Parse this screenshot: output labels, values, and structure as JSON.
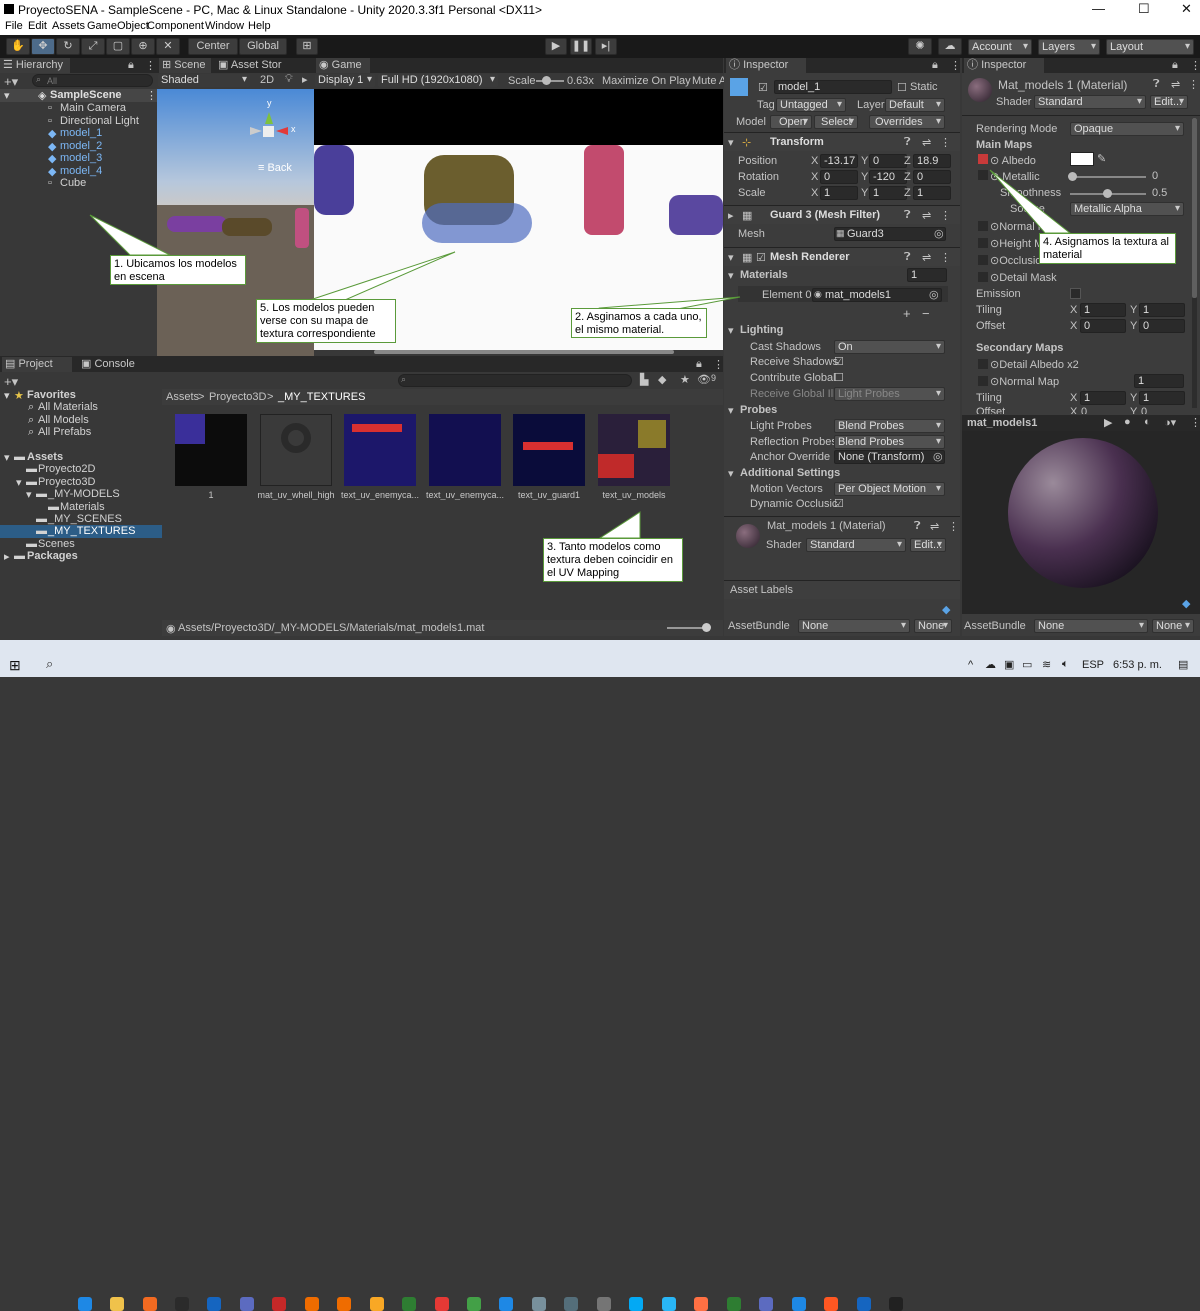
{
  "window": {
    "title": "ProyectoSENA - SampleScene - PC, Mac & Linux Standalone - Unity 2020.3.3f1 Personal <DX11>",
    "minimize": "—",
    "maximize": "☐",
    "close": "✕"
  },
  "menu": [
    "File",
    "Edit",
    "Assets",
    "GameObject",
    "Component",
    "Window",
    "Help"
  ],
  "toolbar": {
    "center": "Center",
    "global": "Global",
    "account": "Account",
    "layers": "Layers",
    "layout": "Layout"
  },
  "hierarchy": {
    "tab": "Hierarchy",
    "search_placeholder": "All",
    "scene": "SampleScene",
    "items": [
      "Main Camera",
      "Directional Light",
      "model_1",
      "model_2",
      "model_3",
      "model_4",
      "Cube"
    ]
  },
  "scene": {
    "tab": "Scene",
    "tab2": "Asset Stor",
    "shading": "Shaded",
    "mode2d": "2D",
    "back": "≡ Back",
    "gizmo_y": "y",
    "gizmo_x": "x"
  },
  "game": {
    "tab": "Game",
    "display": "Display 1",
    "resolution": "Full HD (1920x1080)",
    "scale_label": "Scale",
    "scale_value": "0.63x",
    "maximize": "Maximize On Play",
    "mute": "Mute A"
  },
  "inspector": {
    "tab": "Inspector",
    "name": "model_1",
    "static": "Static",
    "tag_label": "Tag",
    "tag": "Untagged",
    "layer_label": "Layer",
    "layer": "Default",
    "model_label": "Model",
    "open": "Open",
    "select": "Select",
    "overrides": "Overrides",
    "transform": {
      "title": "Transform",
      "position": "Position",
      "rotation": "Rotation",
      "scale": "Scale",
      "px": "-13.17",
      "py": "0",
      "pz": "18.9",
      "rx": "0",
      "ry": "-120",
      "rz": "0",
      "sx": "1",
      "sy": "1",
      "sz": "1"
    },
    "meshfilter": {
      "title": "Guard 3 (Mesh Filter)",
      "mesh_label": "Mesh",
      "mesh": "Guard3"
    },
    "renderer": {
      "title": "Mesh Renderer",
      "materials": "Materials",
      "mat_count": "1",
      "element": "Element 0",
      "element_val": "mat_models1",
      "lighting": "Lighting",
      "cast": "Cast Shadows",
      "cast_val": "On",
      "receive": "Receive Shadows",
      "contribute": "Contribute Global",
      "receive_gi": "Receive Global Ill",
      "receive_gi_val": "Light Probes",
      "probes": "Probes",
      "light_probes": "Light Probes",
      "light_probes_val": "Blend Probes",
      "refl": "Reflection Probes",
      "refl_val": "Blend Probes",
      "anchor": "Anchor Override",
      "anchor_val": "None (Transform)",
      "additional": "Additional Settings",
      "motion": "Motion Vectors",
      "motion_val": "Per Object Motion",
      "dyn": "Dynamic Occlusic"
    },
    "material": {
      "name": "Mat_models 1 (Material)",
      "shader_label": "Shader",
      "shader": "Standard",
      "edit": "Edit..."
    },
    "asset_labels": "Asset Labels",
    "asset_bundle": "AssetBundle",
    "none": "None"
  },
  "inspector2": {
    "tab": "Inspector",
    "name": "Mat_models 1 (Material)",
    "shader_label": "Shader",
    "shader": "Standard",
    "edit": "Edit...",
    "rendering_mode": "Rendering Mode",
    "rendering_val": "Opaque",
    "main_maps": "Main Maps",
    "albedo": "Albedo",
    "metallic": "Metallic",
    "metallic_val": "0",
    "smoothness": "Smoothness",
    "smooth_val": "0.5",
    "source": "Source",
    "source_val": "Metallic Alpha",
    "normal": "Normal Map",
    "height": "Height Map",
    "occlusion": "Occlusion",
    "detail": "Detail Mask",
    "emission": "Emission",
    "tiling": "Tiling",
    "offset": "Offset",
    "tx": "1",
    "ty": "1",
    "ox": "0",
    "oy": "0",
    "secondary": "Secondary Maps",
    "detail_albedo": "Detail Albedo x2",
    "normal2": "Normal Map",
    "normal2_val": "1",
    "tiling2": "Tiling",
    "offset2": "Offset",
    "t2x": "1",
    "t2y": "1",
    "o2x": "0",
    "o2y": "0",
    "preview": "mat_models1",
    "asset_bundle": "AssetBundle",
    "none": "None"
  },
  "project": {
    "tab": "Project",
    "tab2": "Console",
    "count": "9",
    "favorites": "Favorites",
    "fav_items": [
      "All Materials",
      "All Models",
      "All Prefabs"
    ],
    "assets": "Assets",
    "tree": [
      "Proyecto2D",
      "Proyecto3D",
      "_MY-MODELS",
      "Materials",
      "_MY_SCENES",
      "_MY_TEXTURES",
      "Scenes"
    ],
    "packages": "Packages",
    "breadcrumb": [
      "Assets",
      "Proyecto3D",
      "_MY_TEXTURES"
    ],
    "thumbs": [
      "1",
      "mat_uv_whell_high",
      "text_uv_enemyca...",
      "text_uv_enemyca...",
      "text_uv_guard1",
      "text_uv_models"
    ],
    "path": "Assets/Proyecto3D/_MY-MODELS/Materials/mat_models1.mat"
  },
  "callouts": {
    "c1": "1. Ubicamos los modelos en escena",
    "c2": "2. Asginamos a cada uno, el mismo material.",
    "c3": "3. Tanto modelos como textura deben coincidir en el UV Mapping",
    "c4": "4. Asignamos la textura al material",
    "c5": "5. Los modelos pueden verse con su mapa de textura correspondiente"
  },
  "taskbar": {
    "lang": "ESP",
    "time": "6:53 p. m."
  },
  "colors": {
    "accent": "#3a79bb",
    "selected": "#2c5d87",
    "link_blue": "#7cb7f5",
    "callout_border": "#5a9a3a"
  }
}
